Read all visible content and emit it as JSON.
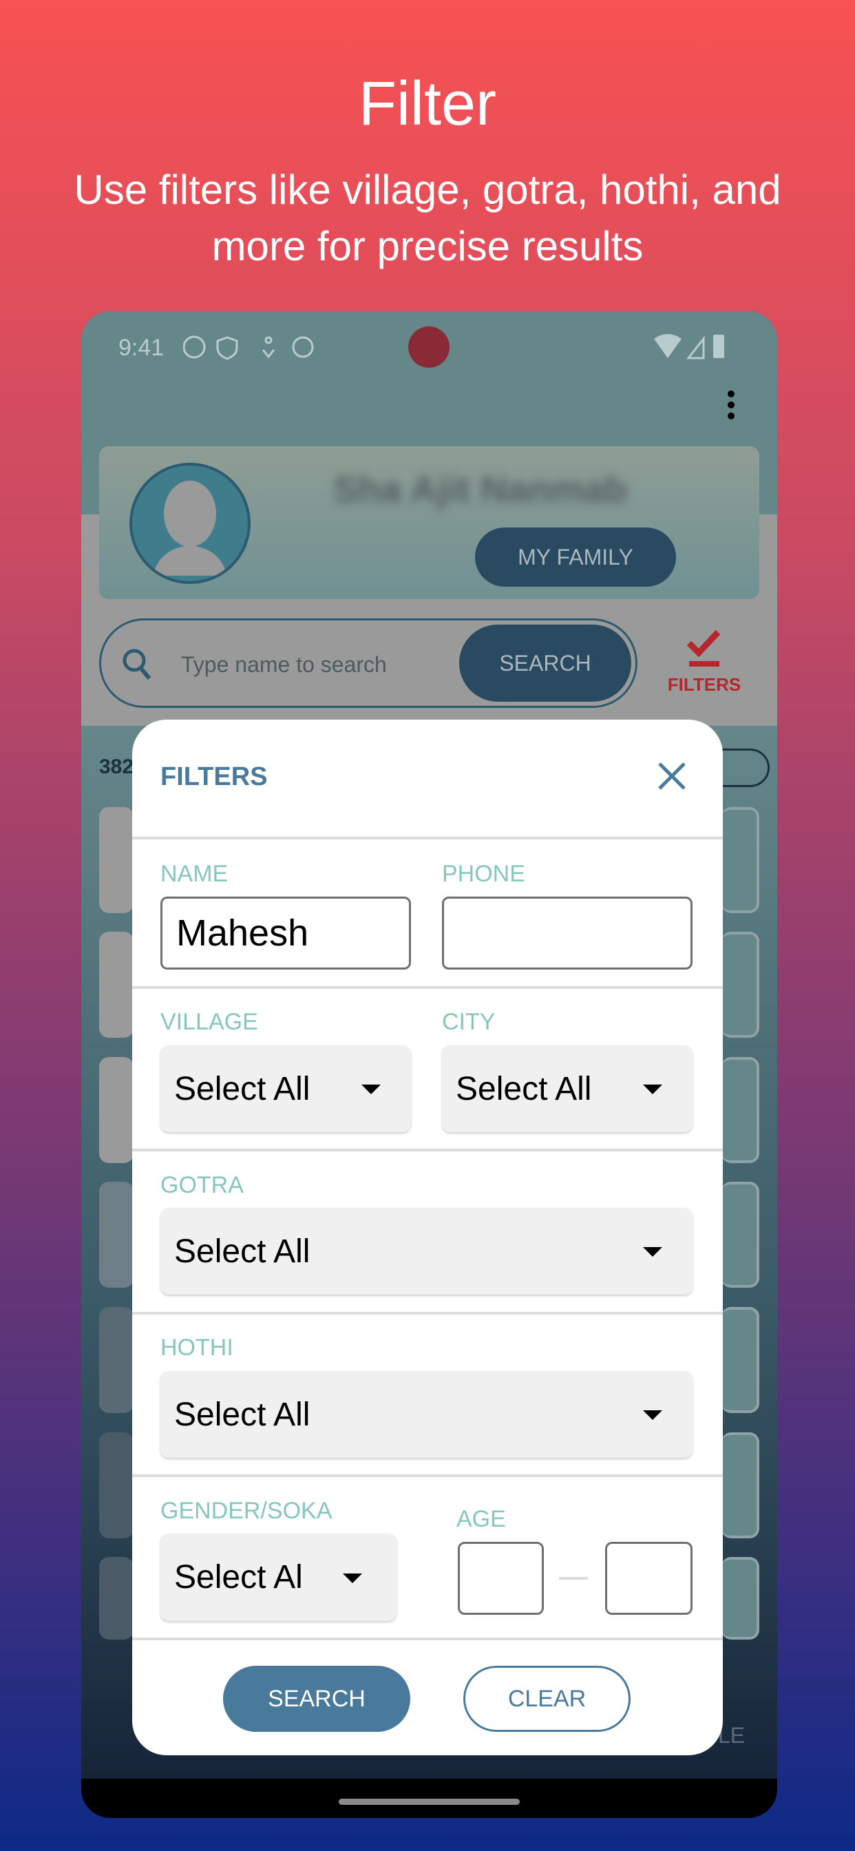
{
  "promo": {
    "title": "Filter",
    "subtitle": "Use filters like village, gotra, hothi, and more for precise results"
  },
  "status_bar": {
    "time": "9:41"
  },
  "profile": {
    "name": "Sha Ajit Nanmab",
    "my_family": "MY FAMILY"
  },
  "search": {
    "placeholder": "Type name to search",
    "button": "SEARCH",
    "filters": "FILTERS"
  },
  "list": {
    "count_partial": "382",
    "bottom_nav_partial": "LE"
  },
  "colors": {
    "accent": "#497a9c",
    "label": "#86c7bb",
    "filters_red": "#b6262d"
  },
  "modal": {
    "title": "FILTERS",
    "name_label": "NAME",
    "name_value": "Mahesh",
    "phone_label": "PHONE",
    "phone_value": "",
    "village_label": "VILLAGE",
    "village_value": "Select All",
    "city_label": "CITY",
    "city_value": "Select All",
    "gotra_label": "GOTRA",
    "gotra_value": "Select All",
    "hothi_label": "HOTHI",
    "hothi_value": "Select All",
    "gender_label": "GENDER/SOKA",
    "gender_value": "Select Al",
    "age_label": "AGE",
    "age_min": "",
    "age_max": "",
    "search_button": "SEARCH",
    "clear_button": "CLEAR"
  }
}
